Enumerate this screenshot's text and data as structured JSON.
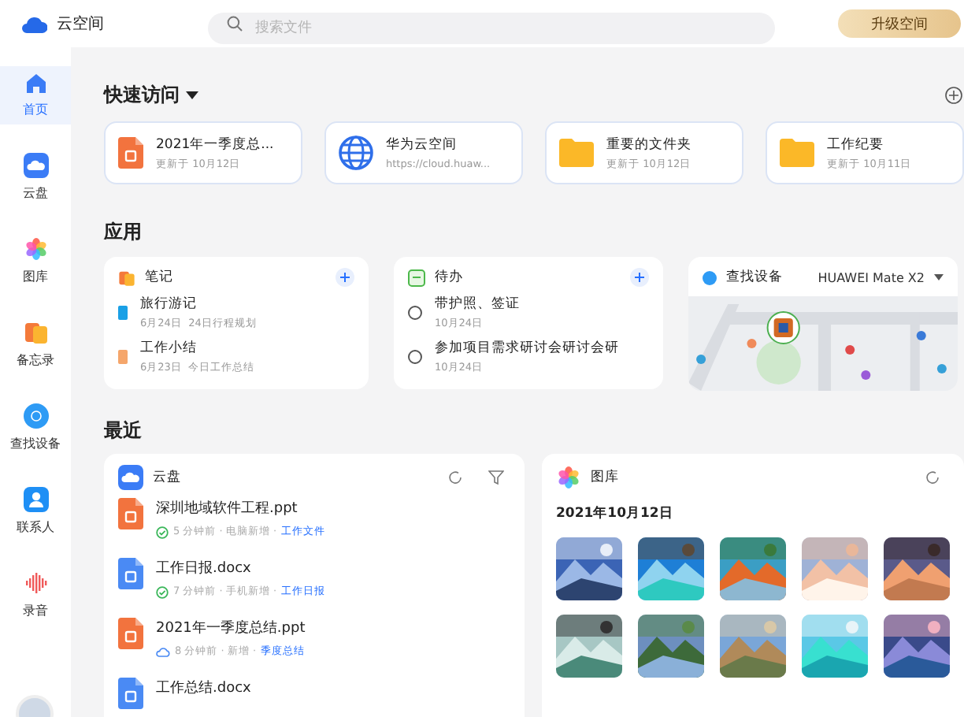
{
  "app": {
    "title": "云空间"
  },
  "search": {
    "placeholder": "搜索文件"
  },
  "upgrade_button": "升级空间",
  "sidebar": {
    "items": [
      {
        "label": "首页",
        "selected": true
      },
      {
        "label": "云盘",
        "selected": false
      },
      {
        "label": "图库",
        "selected": false
      },
      {
        "label": "备忘录",
        "selected": false
      },
      {
        "label": "查找设备",
        "selected": false
      },
      {
        "label": "联系人",
        "selected": false
      },
      {
        "label": "录音",
        "selected": false
      }
    ]
  },
  "quick_access": {
    "title": "快速访问",
    "items": [
      {
        "kind": "ppt",
        "name": "2021年一季度总...",
        "detail": "更新于 10月12日"
      },
      {
        "kind": "web",
        "name": "华为云空间",
        "detail": "https://cloud.huaw..."
      },
      {
        "kind": "folder",
        "name": "重要的文件夹",
        "detail": "更新于 10月12日"
      },
      {
        "kind": "folder",
        "name": "工作纪要",
        "detail": "更新于 10月11日"
      }
    ]
  },
  "apps": {
    "title": "应用",
    "notes": {
      "title": "笔记",
      "items": [
        {
          "title": "旅行游记",
          "date": "6月24日",
          "summary": "24日行程规划",
          "color": "#1aa0e6"
        },
        {
          "title": "工作小结",
          "date": "6月23日",
          "summary": "今日工作总结",
          "color": "#f5a66b"
        }
      ]
    },
    "todo": {
      "title": "待办",
      "items": [
        {
          "title": "带护照、签证",
          "date": "10月24日",
          "checked": false
        },
        {
          "title": "参加项目需求研讨会研讨会研",
          "date": "10月24日",
          "checked": false
        }
      ]
    },
    "find_device": {
      "title": "查找设备",
      "device": "HUAWEI Mate X2"
    }
  },
  "recent": {
    "title": "最近",
    "cloud": {
      "title": "云盘",
      "files": [
        {
          "kind": "ppt",
          "name": "深圳地域软件工程.ppt",
          "synced": true,
          "meta": "5 分钟前 · 电脑新增 ·",
          "folder": "工作文件"
        },
        {
          "kind": "word",
          "name": "工作日报.docx",
          "synced": true,
          "meta": "7 分钟前 · 手机新增 ·",
          "folder": "工作日报"
        },
        {
          "kind": "ppt",
          "name": "2021年一季度总结.ppt",
          "synced": false,
          "meta": "8 分钟前 · 新增 ·",
          "folder": "季度总结"
        },
        {
          "kind": "word",
          "name": "工作总结.docx"
        }
      ]
    },
    "gallery": {
      "title": "图库",
      "date": "2021年10月12日",
      "photos": [
        {
          "kind": "mountain"
        },
        {
          "kind": "beach"
        },
        {
          "kind": "lake"
        },
        {
          "kind": "clouds"
        },
        {
          "kind": "pier"
        },
        {
          "kind": "surf"
        },
        {
          "kind": "river"
        },
        {
          "kind": "town"
        },
        {
          "kind": "lagoon"
        },
        {
          "kind": "dusk"
        }
      ]
    }
  }
}
